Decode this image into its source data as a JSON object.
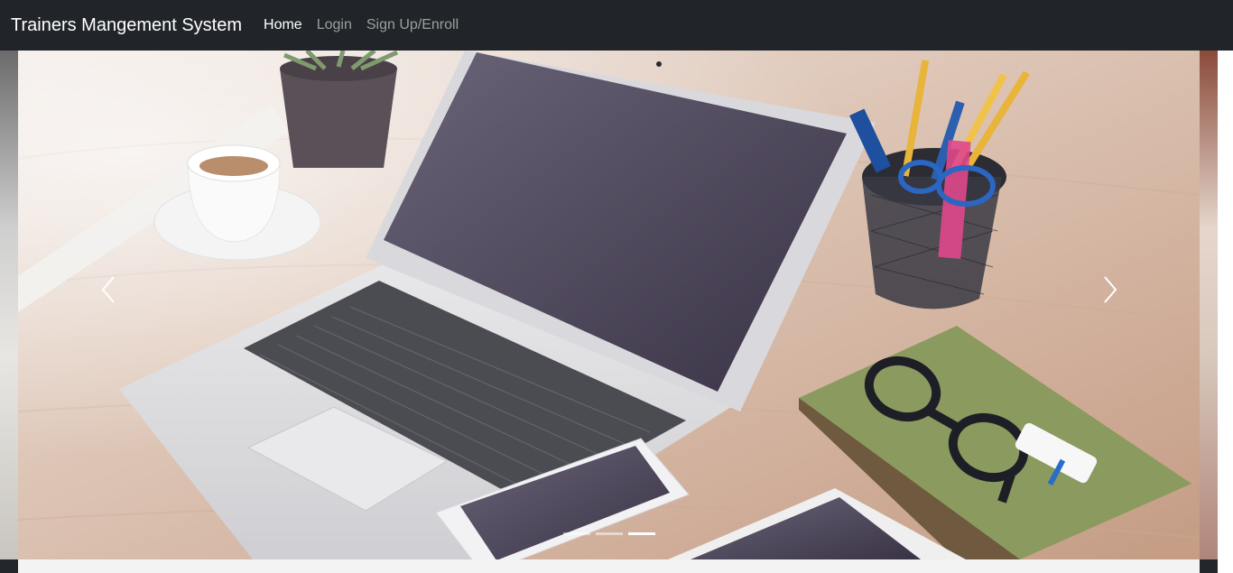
{
  "navbar": {
    "brand": "Trainers Mangement System",
    "links": [
      {
        "label": "Home",
        "active": true
      },
      {
        "label": "Login",
        "active": false
      },
      {
        "label": "Sign Up/Enroll",
        "active": false
      }
    ]
  },
  "carousel": {
    "slide_count": 3,
    "active_index": 2,
    "prev_icon": "chevron-left-icon",
    "next_icon": "chevron-right-icon"
  },
  "colors": {
    "navbar_bg": "#212529",
    "nav_active": "#ffffff",
    "nav_inactive": "rgba(255,255,255,0.55)"
  }
}
